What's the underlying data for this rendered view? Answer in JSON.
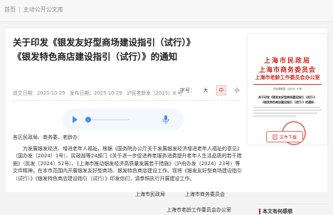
{
  "breadcrumb": {
    "home": "首页",
    "separator": "|",
    "section": "主动公开公文库"
  },
  "article": {
    "title": "关于印发《银发友好型商场建设指引（试行）》《银发特色商店建设指引（试行）》的通知",
    "meta": {
      "date_label": "成文日期：",
      "date": "2025-10-29",
      "publish_label": "发布日期：",
      "publish": "2025-10-29",
      "doc_no": "沪民老龄发〔2025〕8 号"
    },
    "font_size": {
      "label": "字号：",
      "large": "大",
      "medium": "中",
      "small": "小"
    },
    "salutation": "各区民政局、商务委、老龄办：",
    "paragraph1": "为发展银发经济、增进老年人福祉，根据《国务院办公厅关于发展银发经济增进老年人福祉的意见》（国办发〔2024〕1号）、民政部等24部门《关于进一步促进养老服务消费提升老年人生活品质的若干措施》（民发〔2024〕52号）、《上海市推动银发经济高质量发展若干措施》（沪府办发〔2024〕23号）等文件精神，在本市范围内开展银发友好型商场、银发特色商店建设工作。现将《银发友好型商场建设指引（试行）》《银发特色商店建设指引（试行）》印发你们，请参照执行开展建设工作。",
    "signers": [
      "上海市民政局",
      "上海市商务委员会"
    ],
    "signer3": "上海市老龄工作委员会办公室"
  },
  "document_preview": {
    "header_line1": "上海市民政局",
    "header_line2": "上海市商务委员会",
    "header_line3": "上海市老龄工作委员会办公室",
    "doc_no": "沪民老龄发〔2025〕8 号",
    "title_line1": "关于印发《银发友好型商场建设指引（试行）》",
    "title_line2": "《银发特色商店建设指引（试行）》的通知"
  },
  "download": {
    "label": "文件下载",
    "icon": "download-icon"
  },
  "sidebar": {
    "heading": "本文有何感想"
  },
  "colors": {
    "accent": "#d12b21",
    "player": "#3d8ef8"
  }
}
